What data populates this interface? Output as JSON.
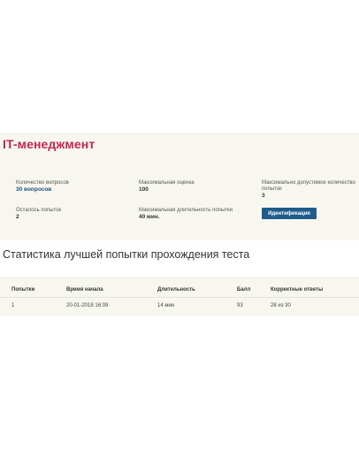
{
  "header": {
    "title": "IT-менеджмент"
  },
  "info": {
    "questions_label": "Количество вопросов",
    "questions_value": "30 вопросов",
    "max_score_label": "Максимальная оценка",
    "max_score_value": "100",
    "max_attempts_label_line1": "Максимально допустимое количество",
    "max_attempts_label_line2": "попыток",
    "max_attempts_value": "3",
    "remaining_label": "Осталось попыток",
    "remaining_value": "2",
    "max_duration_label": "Максимальная длительность попытки",
    "max_duration_value": "40 мин.",
    "identify_button": "Идентификация"
  },
  "stats": {
    "title": "Статистика лучшей попытки прохождения теста",
    "columns": [
      "Попытки",
      "Время начала",
      "Длительность",
      "Балл",
      "Корректные ответы"
    ],
    "rows": [
      [
        "1",
        "20-01-2018 16:09",
        "14 мин",
        "93",
        "28 из 30"
      ]
    ]
  },
  "colors": {
    "accent": "#c7254e",
    "button": "#1f5c8b",
    "value": "#1f4e79"
  }
}
